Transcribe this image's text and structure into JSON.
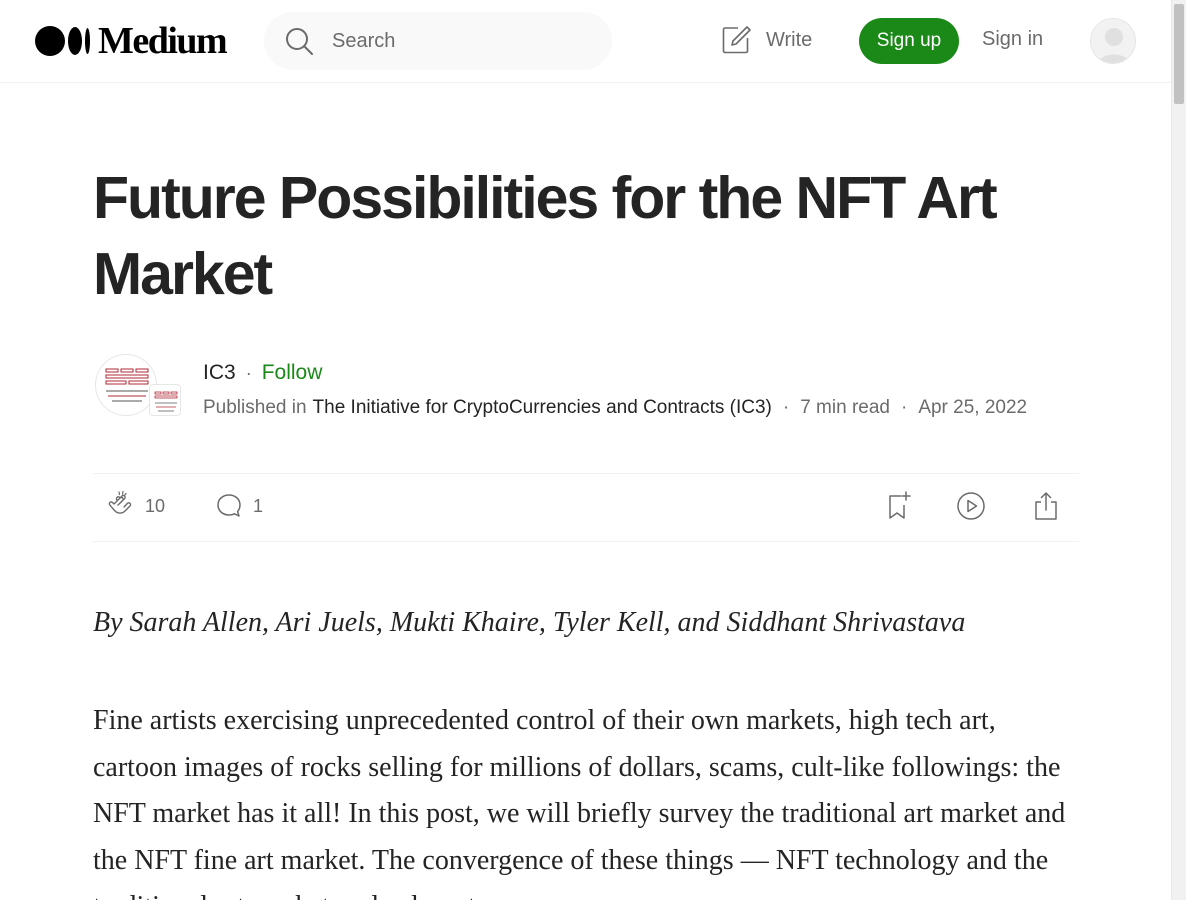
{
  "header": {
    "logo_text": "Medium",
    "search_placeholder": "Search",
    "write_label": "Write",
    "signup_label": "Sign up",
    "signin_label": "Sign in",
    "accent_color": "#1a8917"
  },
  "article": {
    "title": "Future Possibilities for the NFT Art Market",
    "author": "IC3",
    "separator": "·",
    "follow_label": "Follow",
    "published_in_label": "Published in",
    "publication": "The Initiative for CryptoCurrencies and Contracts (IC3)",
    "read_time": "7 min read",
    "date": "Apr 25, 2022",
    "claps": "10",
    "responses": "1",
    "byline": "By Sarah Allen, Ari Juels, Mukti Khaire, Tyler Kell, and Siddhant Shrivastava",
    "body": "Fine artists exercising unprecedented control of their own markets, high tech art, cartoon images of rocks selling for millions of dollars, scams, cult-like followings: the NFT market has it all! In this post, we will briefly survey the traditional art market and the NFT fine art market. The convergence of these things — NFT technology and the traditional art market — leads us to"
  },
  "icons": {
    "search": "search-icon",
    "write": "write-icon",
    "clap": "clap-icon",
    "response": "response-icon",
    "bookmark": "bookmark-icon",
    "listen": "play-icon",
    "share": "share-icon",
    "user": "user-avatar-icon"
  }
}
